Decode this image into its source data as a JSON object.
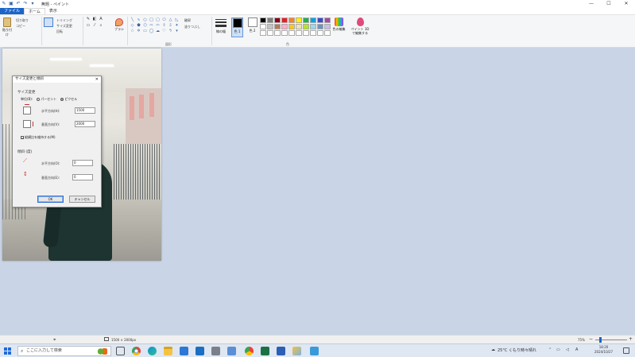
{
  "titlebar": {
    "title": "無題 - ペイント",
    "quick_access": [
      "save-icon",
      "undo-icon",
      "redo-icon",
      "dropdown-icon"
    ],
    "window_controls": {
      "minimize": "—",
      "maximize": "☐",
      "close": "✕"
    }
  },
  "menu": {
    "file": "ファイル",
    "tabs": [
      "ホーム",
      "表示"
    ]
  },
  "ribbon": {
    "clipboard": {
      "paste": "貼り付け",
      "cut": "切り取り",
      "copy": "コピー",
      "label": ""
    },
    "image": {
      "select": "選択",
      "crop": "トリミング",
      "resize": "サイズ変更",
      "rotate": "回転"
    },
    "brushes": "ブラシ",
    "shapes_label": "図形",
    "shape_outline": "輪郭",
    "shape_fill": "塗りつぶし",
    "size": "線の幅",
    "color1": "色 1",
    "color2": "色 2",
    "edit_colors": "色の編集",
    "paint3d": "ペイント 3D で編集する",
    "palette": [
      "#000000",
      "#7f7f7f",
      "#880015",
      "#ed1c24",
      "#ff7f27",
      "#fff200",
      "#22b14c",
      "#00a2e8",
      "#3f48cc",
      "#a349a4",
      "#ffffff",
      "#c3c3c3",
      "#b97a57",
      "#ffaec9",
      "#ffc90e",
      "#efe4b0",
      "#b5e61d",
      "#99d9ea",
      "#7092be",
      "#c8bfe7",
      "#ffffff",
      "#ffffff",
      "#ffffff",
      "#ffffff",
      "#ffffff",
      "#ffffff",
      "#ffffff",
      "#ffffff",
      "#ffffff",
      "#ffffff"
    ],
    "group_labels": {
      "shapes": "図形",
      "colors": "色"
    }
  },
  "dialog": {
    "title": "サイズ変更と傾斜",
    "close": "✕",
    "resize_section": "サイズ変更",
    "unit_label": "単位(B):",
    "unit_percent": "パーセント",
    "unit_pixels": "ピクセル",
    "horizontal_label": "水平方向(H):",
    "horizontal_value": "1500",
    "vertical_label": "垂直方向(V):",
    "vertical_value": "2000",
    "keep_aspect": "縦横比を維持する(M)",
    "skew_section": "傾斜 (度)",
    "skew_h_label": "水平方向(O):",
    "skew_h_value": "0",
    "skew_v_label": "垂直方向(E):",
    "skew_v_value": "0",
    "ok": "OK",
    "cancel": "キャンセル"
  },
  "statusbar": {
    "dimensions": "1500 × 2000px",
    "zoom": "75%",
    "zoom_minus": "−",
    "zoom_plus": "+",
    "zoom_level": 0.12
  },
  "taskbar": {
    "search_placeholder": "ここに入力して検索",
    "weather": "25°C くもり時々晴れ",
    "ime": "A",
    "time": "18:20",
    "date": "2024/10/27",
    "apps": [
      "task-view-icon",
      "chrome-icon",
      "edge-icon",
      "file-explorer-icon",
      "store-icon",
      "mail-icon",
      "calculator-icon",
      "photos-icon",
      "chrome-2-icon",
      "excel-icon",
      "word-icon",
      "paint-icon",
      "remote-icon"
    ]
  }
}
